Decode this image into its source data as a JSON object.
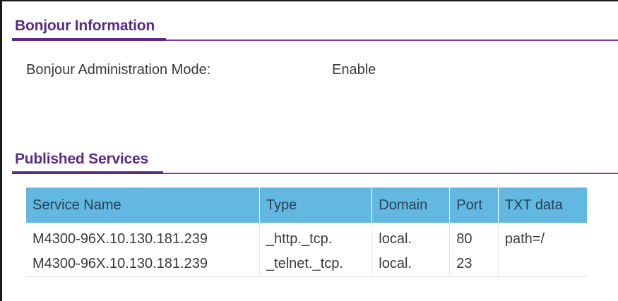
{
  "sections": {
    "bonjour_information": {
      "title": "Bonjour Information"
    },
    "published_services": {
      "title": "Published Services"
    }
  },
  "bonjour": {
    "admin_mode_label": "Bonjour Administration Mode:",
    "admin_mode_value": "Enable"
  },
  "services_table": {
    "headers": [
      "Service Name",
      "Type",
      "Domain",
      "Port",
      "TXT data"
    ],
    "rows": [
      [
        "M4300-96X.10.130.181.239",
        "_http._tcp.",
        "local.",
        "80",
        "path=/"
      ],
      [
        "M4300-96X.10.130.181.239",
        "_telnet._tcp.",
        "local.",
        "23",
        ""
      ]
    ]
  },
  "colors": {
    "section_title": "#5a2b84",
    "table_header_bg": "#62b8e0"
  }
}
